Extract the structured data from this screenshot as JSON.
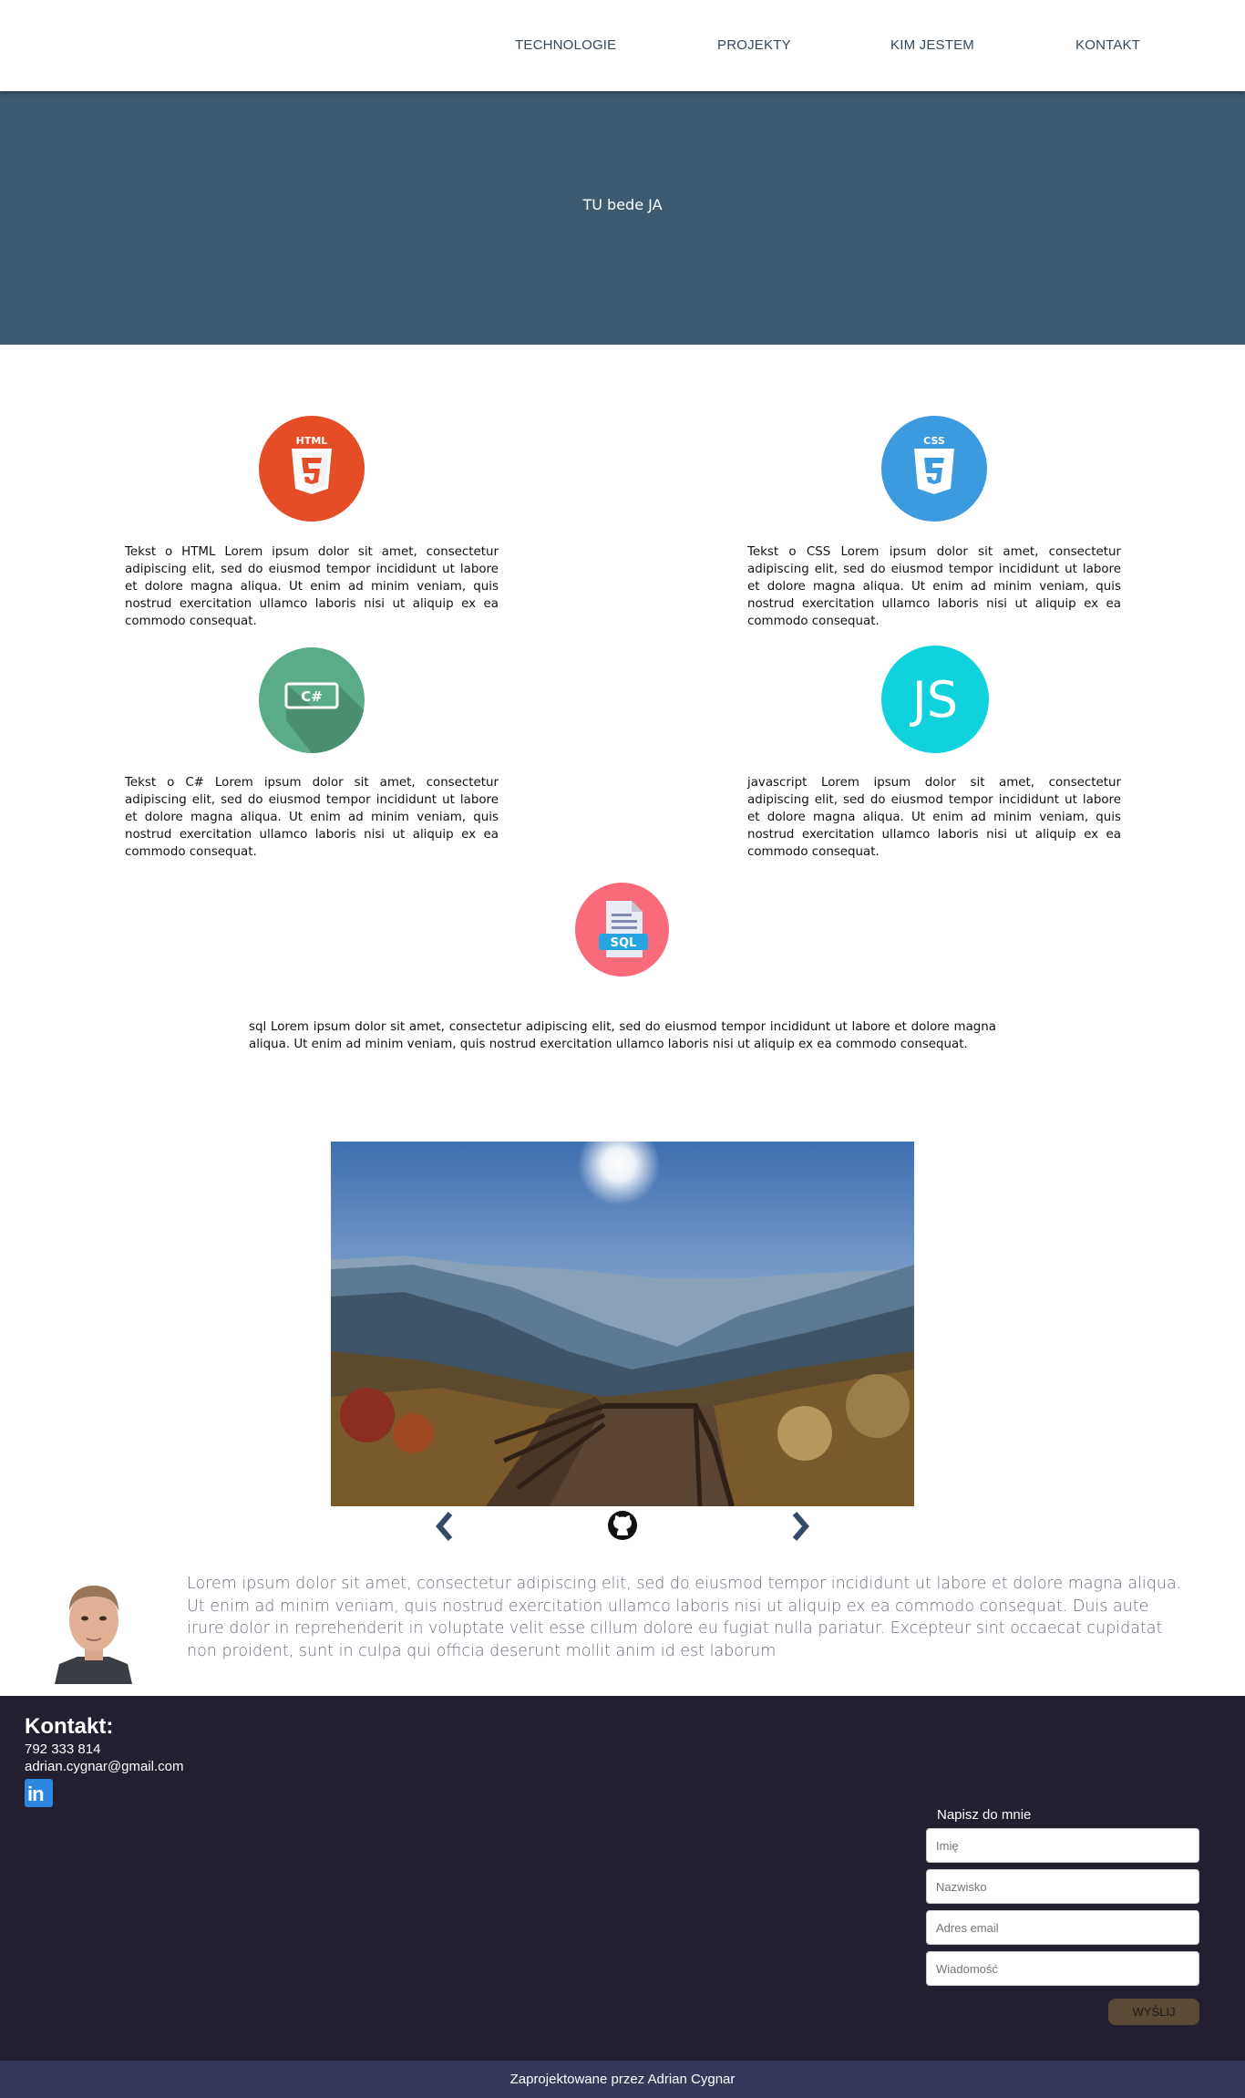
{
  "nav": {
    "items": [
      {
        "label": "TECHNOLOGIE"
      },
      {
        "label": "PROJEKTY"
      },
      {
        "label": "KIM JESTEM"
      },
      {
        "label": "KONTAKT"
      }
    ]
  },
  "hero": {
    "text": "TU bede JA"
  },
  "technologies": [
    {
      "icon": "html5-icon",
      "color": "#e44d26",
      "badge": "HTML",
      "text": "Tekst o HTML Lorem ipsum dolor sit amet, consectetur adipiscing elit, sed do eiusmod tempor incididunt ut labore et dolore magna aliqua. Ut enim ad minim veniam, quis nostrud exercitation ullamco laboris nisi ut aliquip ex ea commodo consequat."
    },
    {
      "icon": "css3-icon",
      "color": "#3c9ade",
      "badge": "CSS",
      "text": "Tekst o CSS Lorem ipsum dolor sit amet, consectetur adipiscing elit, sed do eiusmod tempor incididunt ut labore et dolore magna aliqua. Ut enim ad minim veniam, quis nostrud exercitation ullamco laboris nisi ut aliquip ex ea commodo consequat."
    },
    {
      "icon": "csharp-icon",
      "color": "#5aab87",
      "badge": "C#",
      "text": "Tekst o C# Lorem ipsum dolor sit amet, consectetur adipiscing elit, sed do eiusmod tempor incididunt ut labore et dolore magna aliqua. Ut enim ad minim veniam, quis nostrud exercitation ullamco laboris nisi ut aliquip ex ea commodo consequat."
    },
    {
      "icon": "javascript-icon",
      "color": "#10d2dd",
      "badge": "JS",
      "text": "javascript Lorem ipsum dolor sit amet, consectetur adipiscing elit, sed do eiusmod tempor incididunt ut labore et dolore magna aliqua. Ut enim ad minim veniam, quis nostrud exercitation ullamco laboris nisi ut aliquip ex ea commodo consequat."
    },
    {
      "icon": "sql-icon",
      "color": "#f96b7b",
      "badge": "SQL",
      "text": "sql Lorem ipsum dolor sit amet, consectetur adipiscing elit, sed do eiusmod tempor incididunt ut labore et dolore magna aliqua. Ut enim ad minim veniam, quis nostrud exercitation ullamco laboris nisi ut aliquip ex ea commodo consequat."
    }
  ],
  "slider": {
    "image": "mountain-valley-photo",
    "prev_icon": "chevron-left-icon",
    "next_icon": "chevron-right-icon",
    "github_icon": "github-icon"
  },
  "about": {
    "avatar": "portrait-photo",
    "text": "Lorem ipsum dolor sit amet, consectetur adipiscing elit, sed do eiusmod tempor incididunt ut labore et dolore magna aliqua. Ut enim ad minim veniam, quis nostrud exercitation ullamco laboris nisi ut aliquip ex ea commodo consequat. Duis aute irure dolor in reprehenderit in voluptate velit esse cillum dolore eu fugiat nulla pariatur. Excepteur sint occaecat cupidatat non proident, sunt in culpa qui officia deserunt mollit anim id est laborum"
  },
  "contact": {
    "title": "Kontakt:",
    "phone": "792 333 814",
    "email": "adrian.cygnar@gmail.com",
    "linkedin_icon": "linkedin-icon"
  },
  "form": {
    "title": "Napisz do mnie",
    "fields": [
      {
        "placeholder": "Imię"
      },
      {
        "placeholder": "Nazwisko"
      },
      {
        "placeholder": "Adres email"
      },
      {
        "placeholder": "Wiadomość"
      }
    ],
    "submit": "WYŚLIJ"
  },
  "footer": {
    "text": "Zaprojektowane przez Adrian Cygnar"
  },
  "colors": {
    "nav_text": "#33485b",
    "hero_bg": "#3e5a70",
    "footer_bg": "#231f30",
    "bottom_bar": "#34385a",
    "send_button": "#5a4a35"
  }
}
